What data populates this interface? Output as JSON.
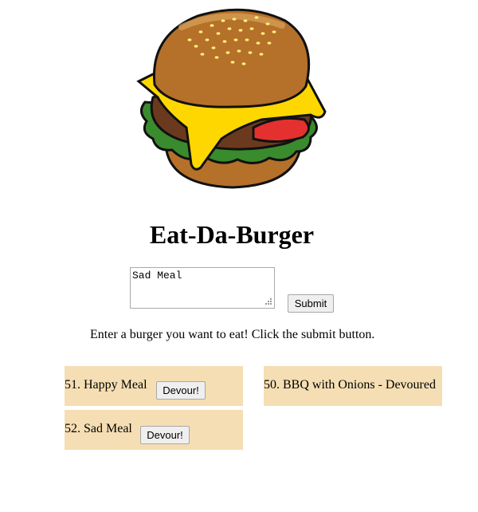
{
  "header": {
    "title": "Eat-Da-Burger"
  },
  "form": {
    "input_value": "Sad Meal",
    "submit_label": "Submit",
    "instructions": "Enter a burger you want to eat! Click the submit button."
  },
  "burgers_to_eat": [
    {
      "label": "51. Happy Meal",
      "button_label": "Devour!"
    },
    {
      "label": "52. Sad Meal",
      "button_label": "Devour!"
    }
  ],
  "burgers_devoured": [
    {
      "label": "50. BBQ with Onions - Devoured"
    }
  ],
  "colors": {
    "card_background": "#f5deb3",
    "cheese": "#ffd700",
    "bun": "#b5702a",
    "lettuce": "#3a8a2e",
    "tomato": "#e53030",
    "patty": "#6b3a1e"
  }
}
